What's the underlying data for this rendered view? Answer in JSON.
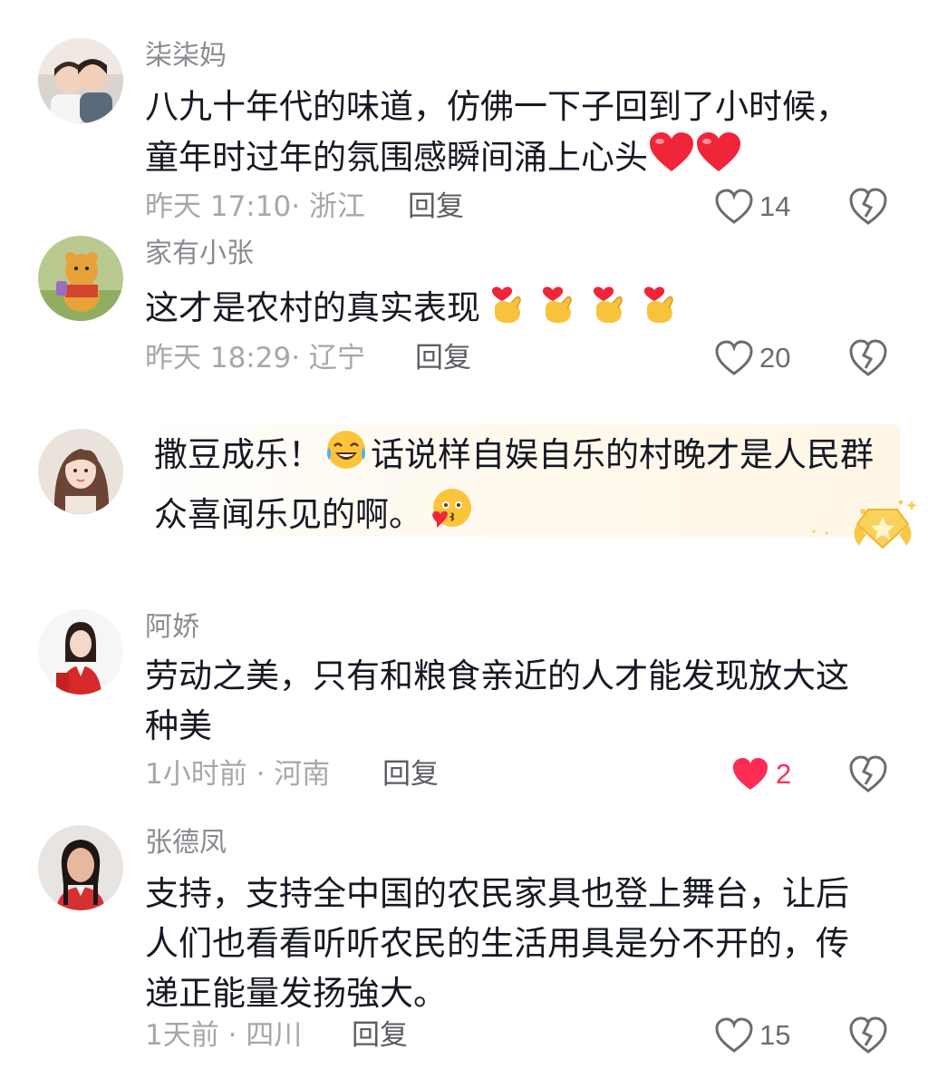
{
  "comments": [
    {
      "username": "柒柒妈",
      "text": "八九十年代的味道，仿佛一下子回到了小时候，童年时过年的氛围感瞬间涌上心头",
      "emoji_suffix": "heart-emoji x2",
      "time": "昨天 17:10",
      "location": "浙江",
      "meta": "昨天 17:10· 浙江",
      "reply_label": "回复",
      "likes": "14",
      "liked": false
    },
    {
      "username": "家有小张",
      "text": "这才是农村的真实表现",
      "emoji_suffix": "finger-heart-emoji x4",
      "time": "昨天 18:29",
      "location": "辽宁",
      "meta": "昨天 18:29· 辽宁",
      "reply_label": "回复",
      "likes": "20",
      "liked": false
    },
    {
      "text_part1": "撒豆成乐！",
      "text_part2": "话说样自娱自乐的村晚才是人民群众喜闻乐见的啊。",
      "emojis": [
        "tears-of-joy-emoji",
        "blowing-kiss-emoji"
      ],
      "highlighted": true
    },
    {
      "username": "阿娇",
      "text": "劳动之美，只有和粮食亲近的人才能发现放大这种美",
      "time": "1小时前",
      "location": "河南",
      "meta": "1小时前 · 河南",
      "reply_label": "回复",
      "likes": "2",
      "liked": true
    },
    {
      "username": "张德凤",
      "text": "支持，支持全中国的农民家具也登上舞台，让后人们也看看听听农民的生活用具是分不开的，传递正能量发扬強大。",
      "time": "1天前",
      "location": "四川",
      "meta": "1天前 · 四川",
      "reply_label": "回复",
      "likes": "15",
      "liked": false
    }
  ],
  "colors": {
    "username": "#8a8b91",
    "body_text": "#161823",
    "meta": "#a6a7ab",
    "like_active": "#fe2c55"
  }
}
